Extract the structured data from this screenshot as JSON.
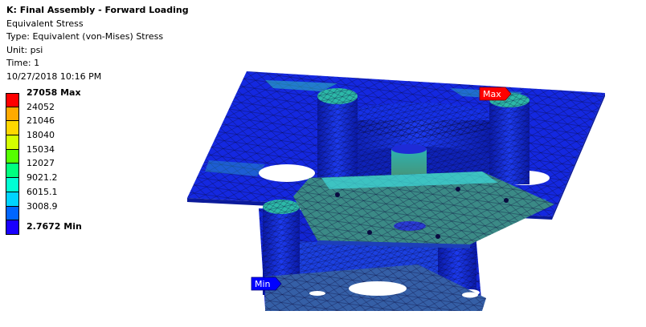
{
  "header": {
    "title": "K: Final Assembly - Forward Loading",
    "result_name": "Equivalent Stress",
    "type_line": "Type: Equivalent (von-Mises) Stress",
    "unit_line": "Unit: psi",
    "time_line": "Time: 1",
    "timestamp": "10/27/2018 10:16 PM"
  },
  "legend": {
    "labels": [
      "27058 Max",
      "24052",
      "21046",
      "18040",
      "15034",
      "12027",
      "9021.2",
      "6015.1",
      "3008.9",
      "2.7672 Min"
    ],
    "colors": [
      "#ff0000",
      "#ffaa00",
      "#ffd700",
      "#d4ff00",
      "#55ff00",
      "#00ff7f",
      "#00ffd4",
      "#00d4ff",
      "#0066ff",
      "#1a00ff"
    ]
  },
  "probes": {
    "max_label": "Max",
    "max_color": "#ff0000",
    "min_label": "Min",
    "min_color": "#0000ff"
  },
  "model_colors": {
    "primary": "#1220d8",
    "secondary": "#0b2db0",
    "highlight": "#2ecad0",
    "stress_green": "#3b9a8d",
    "edge": "#0b0b4a"
  }
}
